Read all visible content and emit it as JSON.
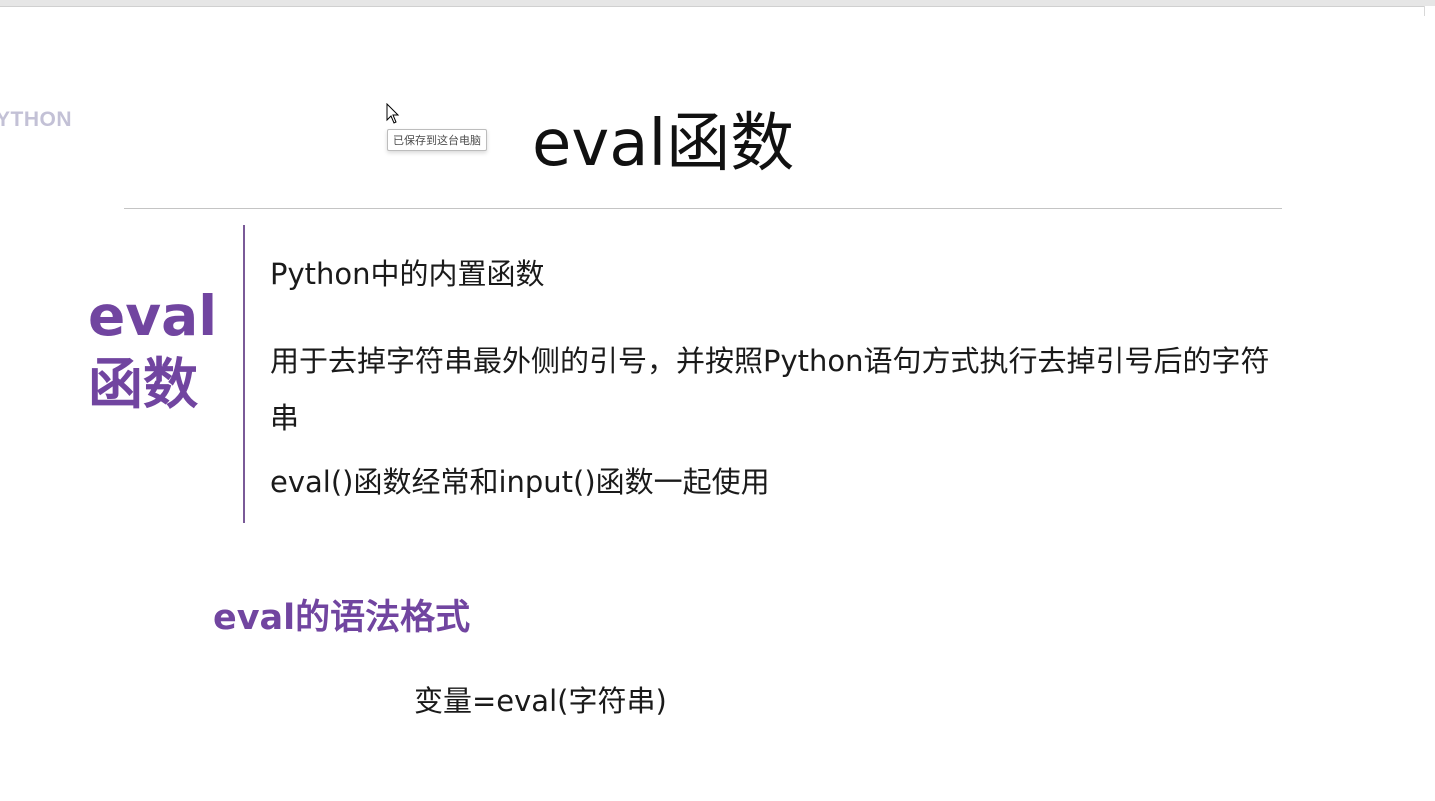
{
  "logo": {
    "text": "YTHON"
  },
  "tooltip": {
    "text": "已保存到这台电脑"
  },
  "slide": {
    "title": "eval函数",
    "side_title_line1": "eval",
    "side_title_line2": "函数",
    "descriptions": [
      "Python中的内置函数",
      "用于去掉字符串最外侧的引号，并按照Python语句方式执行去掉引号后的字符串",
      "eval()函数经常和input()函数一起使用"
    ],
    "syntax_heading": "eval的语法格式",
    "syntax_code": "变量=eval(字符串)"
  },
  "colors": {
    "accent": "#7145a0",
    "logo": "#c3c1d6",
    "rule": "#c4c4c4"
  },
  "icons": {
    "cursor": "arrow-cursor-icon"
  }
}
